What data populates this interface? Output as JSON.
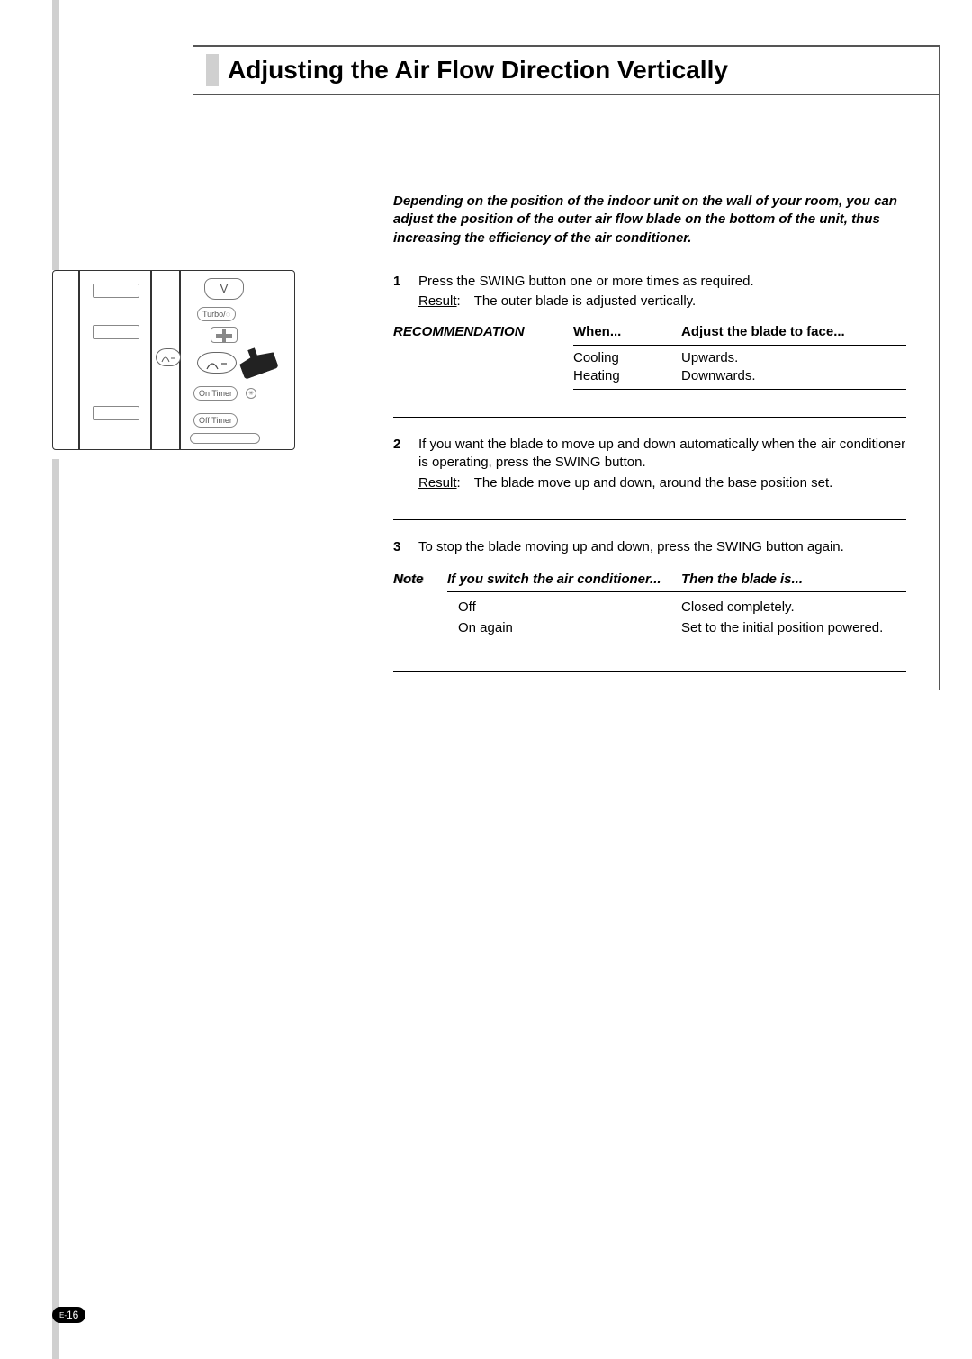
{
  "page": {
    "title": "Adjusting the Air Flow Direction Vertically",
    "page_number_prefix": "E-",
    "page_number": "16"
  },
  "intro": "Depending on the position of the indoor unit on the wall of your room, you can adjust the position of the outer air flow blade on the bottom of the unit, thus increasing the efficiency of the air conditioner.",
  "steps": [
    {
      "num": "1",
      "text": "Press the SWING button one or more times as required.",
      "result_label": "Result",
      "result_text": ": The outer blade is adjusted vertically."
    },
    {
      "num": "2",
      "text": "If you want the blade to move up and down automatically when the air conditioner is operating, press the SWING button.",
      "result_label": "Result",
      "result_text": ": The blade move up and down, around the base position set."
    },
    {
      "num": "3",
      "text": "To stop the blade moving up and down, press the SWING button again."
    }
  ],
  "recommendation": {
    "label": "RECOMMENDATION",
    "head_col1": "When...",
    "head_col2": "Adjust the blade to face...",
    "rows": [
      {
        "c1": "Cooling",
        "c2": "Upwards."
      },
      {
        "c1": "Heating",
        "c2": "Downwards."
      }
    ]
  },
  "note": {
    "label": "Note",
    "head_col1": "If you switch the air conditioner...",
    "head_col2": "Then the blade is...",
    "rows": [
      {
        "c1": "Off",
        "c2": "Closed completely."
      },
      {
        "c1": "On again",
        "c2": "Set to the initial position powered."
      }
    ]
  },
  "remote": {
    "v": "V",
    "turbo": "Turbo/",
    "on_timer": "On Timer",
    "off_timer": "Off Timer"
  }
}
